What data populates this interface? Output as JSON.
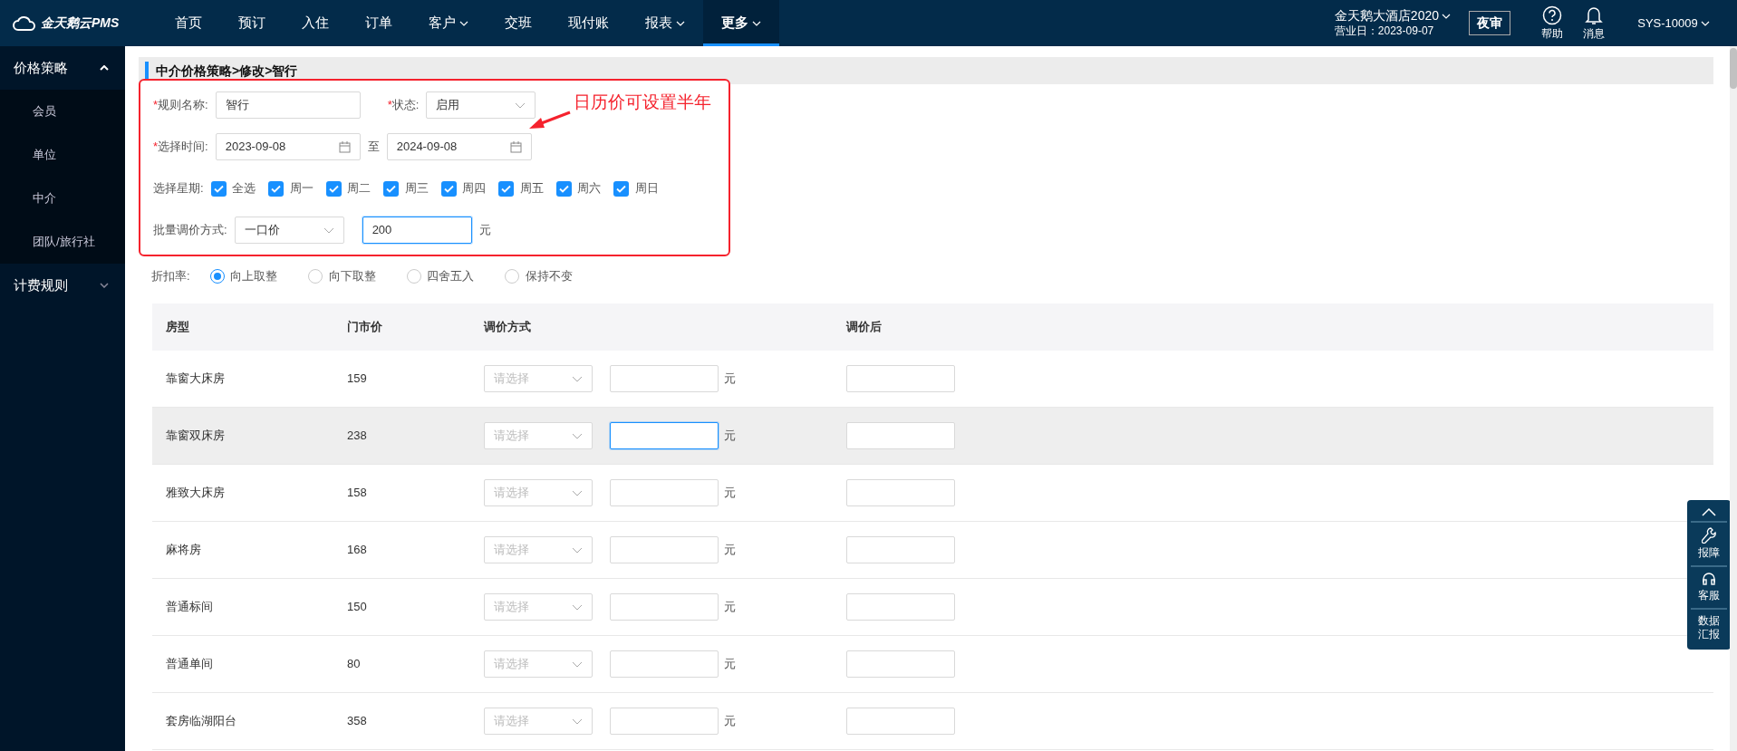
{
  "nav": {
    "logo": "金天鹅云PMS",
    "items": [
      {
        "label": "首页",
        "dropdown": false,
        "selected": false
      },
      {
        "label": "预订",
        "dropdown": false,
        "selected": false
      },
      {
        "label": "入住",
        "dropdown": false,
        "selected": false
      },
      {
        "label": "订单",
        "dropdown": false,
        "selected": false
      },
      {
        "label": "客户",
        "dropdown": true,
        "selected": false
      },
      {
        "label": "交班",
        "dropdown": false,
        "selected": false
      },
      {
        "label": "现付账",
        "dropdown": false,
        "selected": false
      },
      {
        "label": "报表",
        "dropdown": true,
        "selected": false
      },
      {
        "label": "更多",
        "dropdown": true,
        "selected": true
      }
    ],
    "hotel": "金天鹅大酒店2020",
    "business_date": "营业日：2023-09-07",
    "night_audit": "夜审",
    "help": "帮助",
    "messages": "消息",
    "user": "SYS-10009"
  },
  "sidebar": [
    {
      "label": "价格策略",
      "expanded": true,
      "children": [
        {
          "label": "会员"
        },
        {
          "label": "单位"
        },
        {
          "label": "中介"
        },
        {
          "label": "团队/旅行社"
        }
      ]
    },
    {
      "label": "计费规则",
      "expanded": false
    }
  ],
  "breadcrumb": "中介价格策略>修改>智行",
  "form": {
    "name_label": {
      "mark": "*",
      "text": "规则名称:"
    },
    "name_value": "智行",
    "status_label": {
      "mark": "*",
      "text": "状态:"
    },
    "status_value": "启用",
    "time_label": {
      "mark": "*",
      "text": "选择时间:"
    },
    "start_date": "2023-09-08",
    "to": "至",
    "end_date": "2024-09-08",
    "week_label": {
      "text": "选择星期:"
    },
    "weekdays": [
      {
        "label": "全选",
        "checked": true
      },
      {
        "label": "周一",
        "checked": true
      },
      {
        "label": "周二",
        "checked": true
      },
      {
        "label": "周三",
        "checked": true
      },
      {
        "label": "周四",
        "checked": true
      },
      {
        "label": "周五",
        "checked": true
      },
      {
        "label": "周六",
        "checked": true
      },
      {
        "label": "周日",
        "checked": true
      }
    ],
    "batch_label": {
      "text": "批量调价方式:"
    },
    "batch_mode": "一口价",
    "batch_value": "200",
    "unit": "元"
  },
  "annotation": "日历价可设置半年",
  "rounding": {
    "label": "折扣率:",
    "options": [
      {
        "label": "向上取整",
        "selected": true
      },
      {
        "label": "向下取整",
        "selected": false
      },
      {
        "label": "四舍五入",
        "selected": false
      },
      {
        "label": "保持不变",
        "selected": false
      }
    ]
  },
  "table": {
    "columns": [
      "房型",
      "门市价",
      "调价方式",
      "调价后"
    ],
    "rows": [
      {
        "room": "靠窗大床房",
        "price": "159",
        "placeholder": "请选择",
        "unit": "元",
        "highlighted": false,
        "focused": false
      },
      {
        "room": "靠窗双床房",
        "price": "238",
        "placeholder": "请选择",
        "unit": "元",
        "highlighted": true,
        "focused": true
      },
      {
        "room": "雅致大床房",
        "price": "158",
        "placeholder": "请选择",
        "unit": "元",
        "highlighted": false,
        "focused": false
      },
      {
        "room": "麻将房",
        "price": "168",
        "placeholder": "请选择",
        "unit": "元",
        "highlighted": false,
        "focused": false
      },
      {
        "room": "普通标间",
        "price": "150",
        "placeholder": "请选择",
        "unit": "元",
        "highlighted": false,
        "focused": false
      },
      {
        "room": "普通单间",
        "price": "80",
        "placeholder": "请选择",
        "unit": "元",
        "highlighted": false,
        "focused": false
      },
      {
        "room": "套房临湖阳台",
        "price": "358",
        "placeholder": "请选择",
        "unit": "元",
        "highlighted": false,
        "focused": false
      }
    ]
  },
  "float_panel": [
    {
      "kind": "up"
    },
    {
      "kind": "wrench",
      "label": "报障"
    },
    {
      "kind": "headset",
      "label": "客服"
    },
    {
      "kind": "text",
      "label": "数据汇报"
    }
  ]
}
